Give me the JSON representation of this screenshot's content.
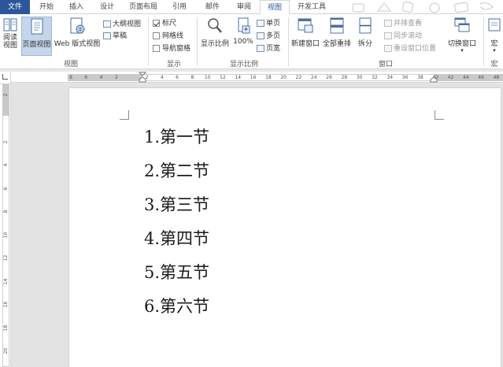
{
  "tabs": [
    {
      "label": "文件",
      "kind": "file"
    },
    {
      "label": "开始"
    },
    {
      "label": "插入"
    },
    {
      "label": "设计"
    },
    {
      "label": "页面布局"
    },
    {
      "label": "引用"
    },
    {
      "label": "邮件"
    },
    {
      "label": "审阅"
    },
    {
      "label": "视图",
      "active": true
    },
    {
      "label": "开发工具"
    }
  ],
  "ribbon": {
    "views": {
      "read_mode": "阅读\n视图",
      "print_layout": "页面视图",
      "web_layout": "Web 版式视图",
      "outline": "大纲视图",
      "draft": "草稿",
      "group_label": "视图"
    },
    "show": {
      "ruler": "标尺",
      "gridlines": "网格线",
      "nav_pane": "导航窗格",
      "group_label": "显示",
      "ruler_checked": true,
      "gridlines_checked": false,
      "nav_pane_checked": false
    },
    "zoom": {
      "zoom": "显示比例",
      "hundred": "100%",
      "one_page": "单页",
      "multi_page": "多页",
      "page_width": "页宽",
      "group_label": "显示比例"
    },
    "window": {
      "new_window": "新建窗口",
      "arrange_all": "全部重排",
      "split": "拆分",
      "side_by_side": "并排查看",
      "sync_scroll": "同步滚动",
      "reset_position": "重设窗口位置",
      "switch_windows": "切换窗口",
      "group_label": "窗口"
    },
    "macros": {
      "label": "宏",
      "group_label": "宏"
    }
  },
  "ruler": {
    "h_ticks": [
      "8",
      "6",
      "4",
      "2",
      "2",
      "4",
      "6",
      "8",
      "10",
      "12",
      "14",
      "16",
      "18",
      "20",
      "22",
      "24",
      "26",
      "28",
      "30",
      "32",
      "34",
      "36",
      "38",
      "40",
      "42",
      "44",
      "46",
      "48"
    ],
    "v_ticks": [
      "2",
      "2",
      "4",
      "6",
      "8",
      "10",
      "12",
      "14",
      "16",
      "18",
      "20"
    ]
  },
  "document": {
    "lines": [
      "1.第一节",
      "2.第二节",
      "3.第三节",
      "4.第四节",
      "5.第五节",
      "6.第六节"
    ]
  }
}
